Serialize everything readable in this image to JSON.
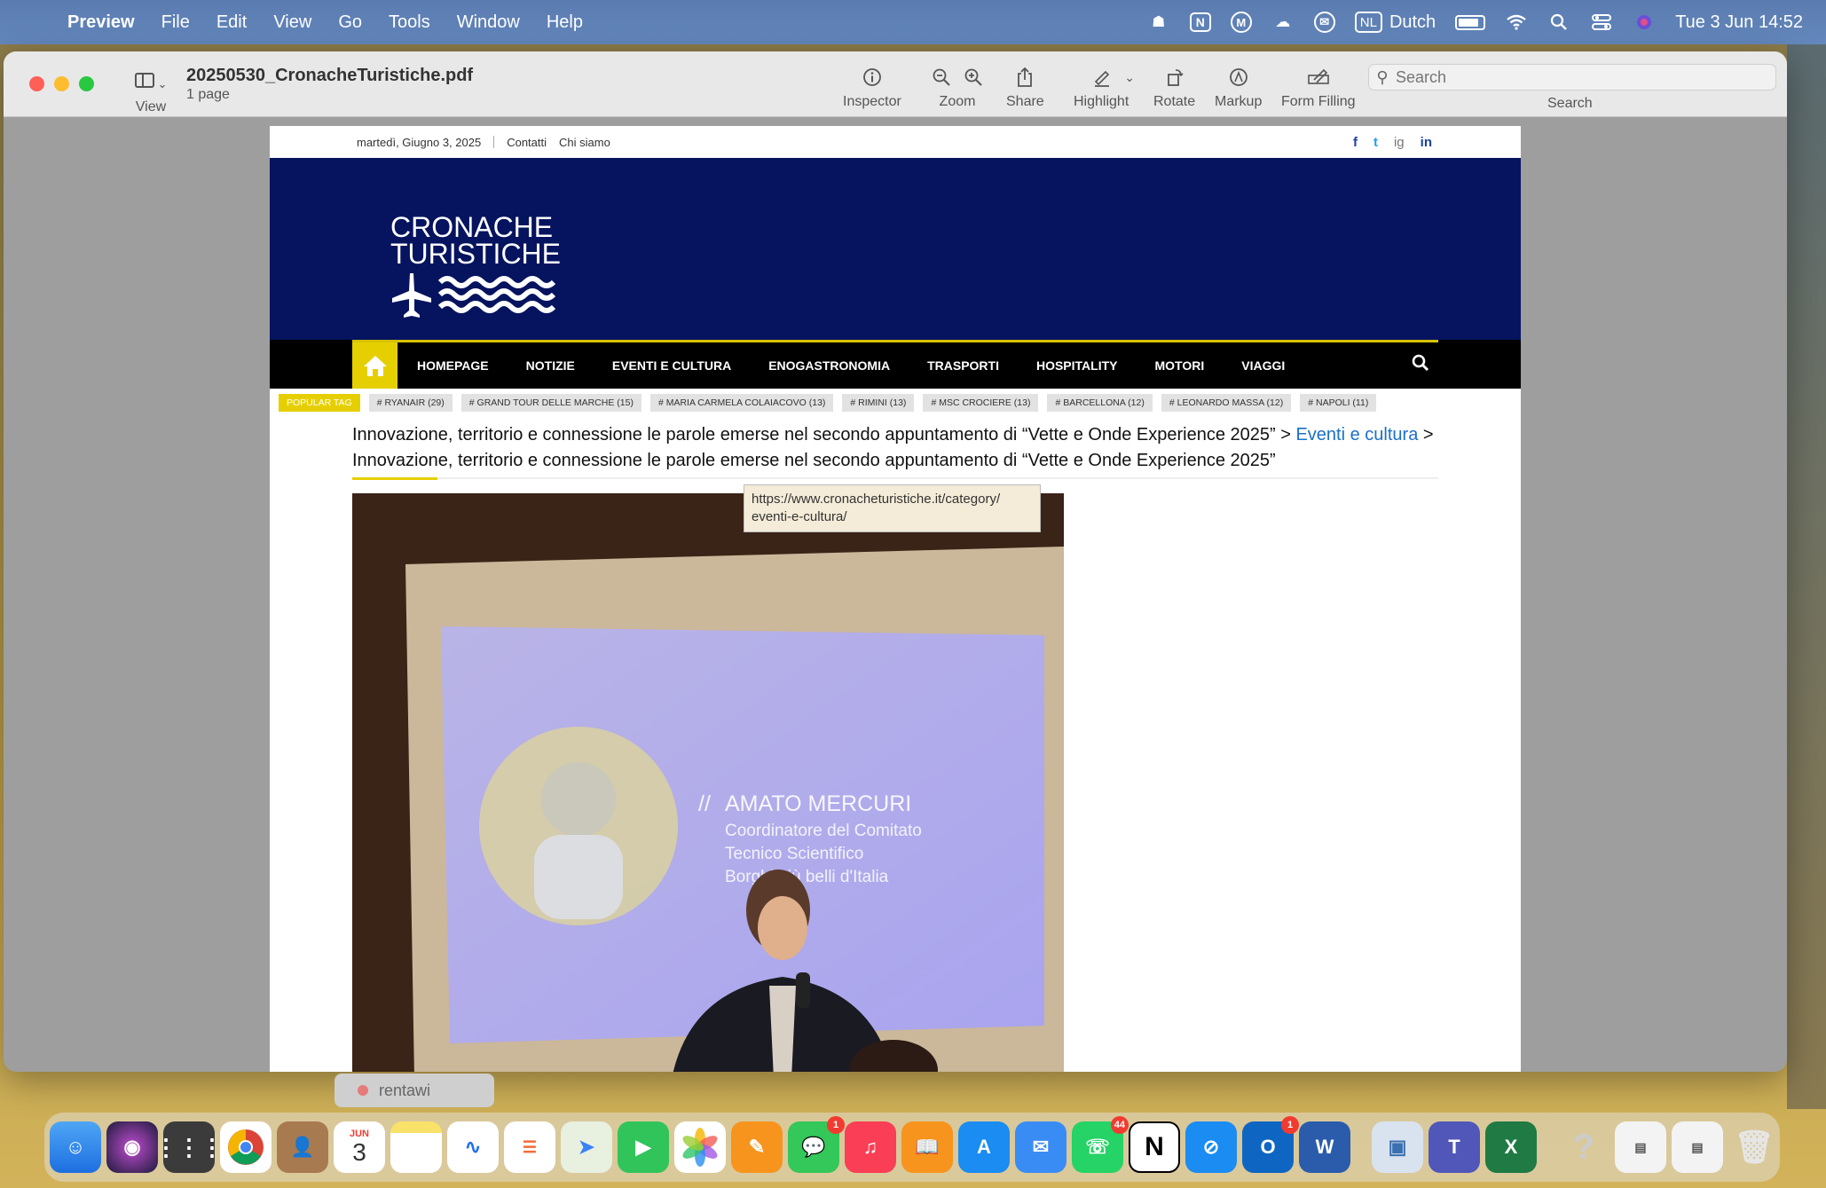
{
  "menubar": {
    "app": "Preview",
    "items": [
      "File",
      "Edit",
      "View",
      "Go",
      "Tools",
      "Window",
      "Help"
    ],
    "language_code": "NL",
    "language": "Dutch",
    "datetime": "Tue 3 Jun  14:52"
  },
  "window": {
    "title": "20250530_CronacheTuristiche.pdf",
    "subtitle": "1 page",
    "view_label": "View",
    "tools": [
      "Inspector",
      "Zoom",
      "Share",
      "Highlight",
      "Rotate",
      "Markup",
      "Form Filling"
    ],
    "search_placeholder": "Search",
    "search_label": "Search"
  },
  "page": {
    "date": "martedì, Giugno 3, 2025",
    "links": [
      "Contatti",
      "Chi siamo"
    ],
    "social": [
      "f",
      "t",
      "ig",
      "in"
    ],
    "logo_line1": "CRONACHE",
    "logo_line2": "TURISTICHE",
    "nav": [
      "HOMEPAGE",
      "NOTIZIE",
      "EVENTI E CULTURA",
      "ENOGASTRONOMIA",
      "TRASPORTI",
      "HOSPITALITY",
      "MOTORI",
      "VIAGGI"
    ],
    "popular_tag": "POPULAR TAG",
    "tags": [
      "# RYANAIR (29)",
      "# GRAND TOUR DELLE MARCHE (15)",
      "# MARIA CARMELA COLAIACOVO (13)",
      "# RIMINI (13)",
      "# MSC CROCIERE (13)",
      "# BARCELLONA (12)",
      "# LEONARDO MASSA (12)",
      "# NAPOLI (11)"
    ],
    "breadcrumb_first": "Innovazione, territorio e connessione le parole emerse nel secondo appuntamento di “Vette e Onde Experience 2025” >",
    "breadcrumb_link": "Eventi e cultura",
    "breadcrumb_sep": ">",
    "breadcrumb_last": "Innovazione, territorio e connessione le parole emerse nel secondo appuntamento di “Vette e Onde Experience 2025”",
    "tooltip_line1": "https://www.cronacheturistiche.it/category/",
    "tooltip_line2": "eventi-e-cultura/",
    "slide_name": "AMATO MERCURI",
    "slide_lines": [
      "Coordinatore del Comitato",
      "Tecnico Scientifico",
      "Borghi più belli d'Italia"
    ]
  },
  "background_tab": "rentawi",
  "dock": {
    "calendar_month": "JUN",
    "calendar_day": "3",
    "badges": {
      "messages": "1",
      "whatsapp": "44",
      "outlook": "1"
    }
  }
}
